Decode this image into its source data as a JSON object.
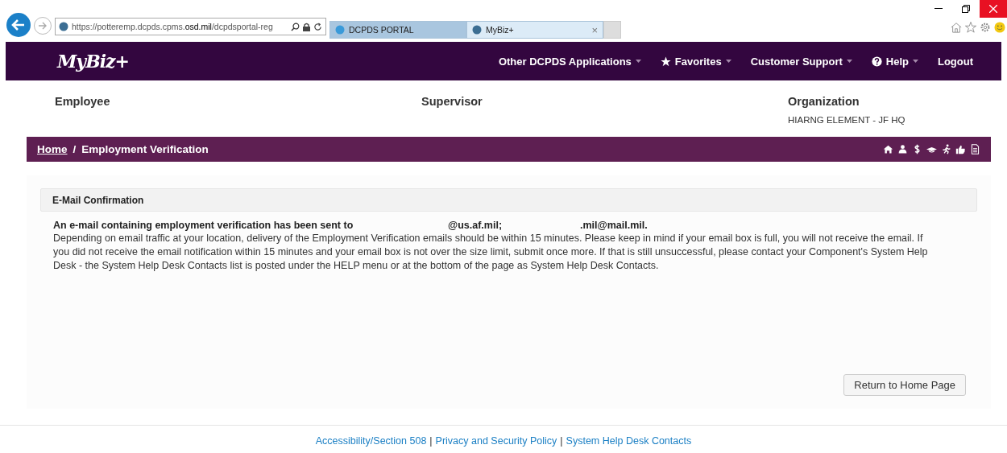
{
  "browser": {
    "url_prefix": "https://potteremp.dcpds.cpms.",
    "url_domain": "osd.mil",
    "url_rest": "/dcpdsportal-reg",
    "tabs": [
      {
        "label": "DCPDS PORTAL",
        "selected": false
      },
      {
        "label": "MyBiz+",
        "selected": true,
        "close": "×"
      }
    ]
  },
  "header": {
    "logo": "MyBiz+",
    "menu": [
      {
        "label": "Other DCPDS Applications",
        "dropdown": true
      },
      {
        "label": "Favorites",
        "dropdown": true
      },
      {
        "label": "Customer Support",
        "dropdown": true
      },
      {
        "label": "Help",
        "dropdown": true
      },
      {
        "label": "Logout",
        "dropdown": false
      }
    ]
  },
  "info": [
    {
      "heading": "Employee"
    },
    {
      "heading": "Supervisor"
    },
    {
      "heading": "Organization",
      "value": "HIARNG ELEMENT - JF HQ"
    }
  ],
  "breadcrumb": {
    "home": "Home",
    "separator": "/",
    "current": "Employment Verification"
  },
  "panel": {
    "title": "E-Mail Confirmation",
    "sent_line": [
      "An e-mail containing employment verification has been sent to",
      "@us.af.mil;",
      ".mil@mail.mil."
    ],
    "body": "Depending on email traffic at your location, delivery of the Employment Verification emails should be within 15 minutes. Please keep in mind if your email box is full, you will not receive the email. If you did not receive the email notification within 15 minutes and your email box is not over the size limit, submit once more. If that is still unsuccessful, please contact your Component's System Help Desk - the System Help Desk Contacts list is posted under the HELP menu or at the bottom of the page as System Help Desk Contacts.",
    "button": "Return to Home Page"
  },
  "footer": {
    "links": [
      "Accessibility/Section 508",
      "Privacy and Security Policy",
      "System Help Desk Contacts"
    ],
    "separator": "|"
  }
}
